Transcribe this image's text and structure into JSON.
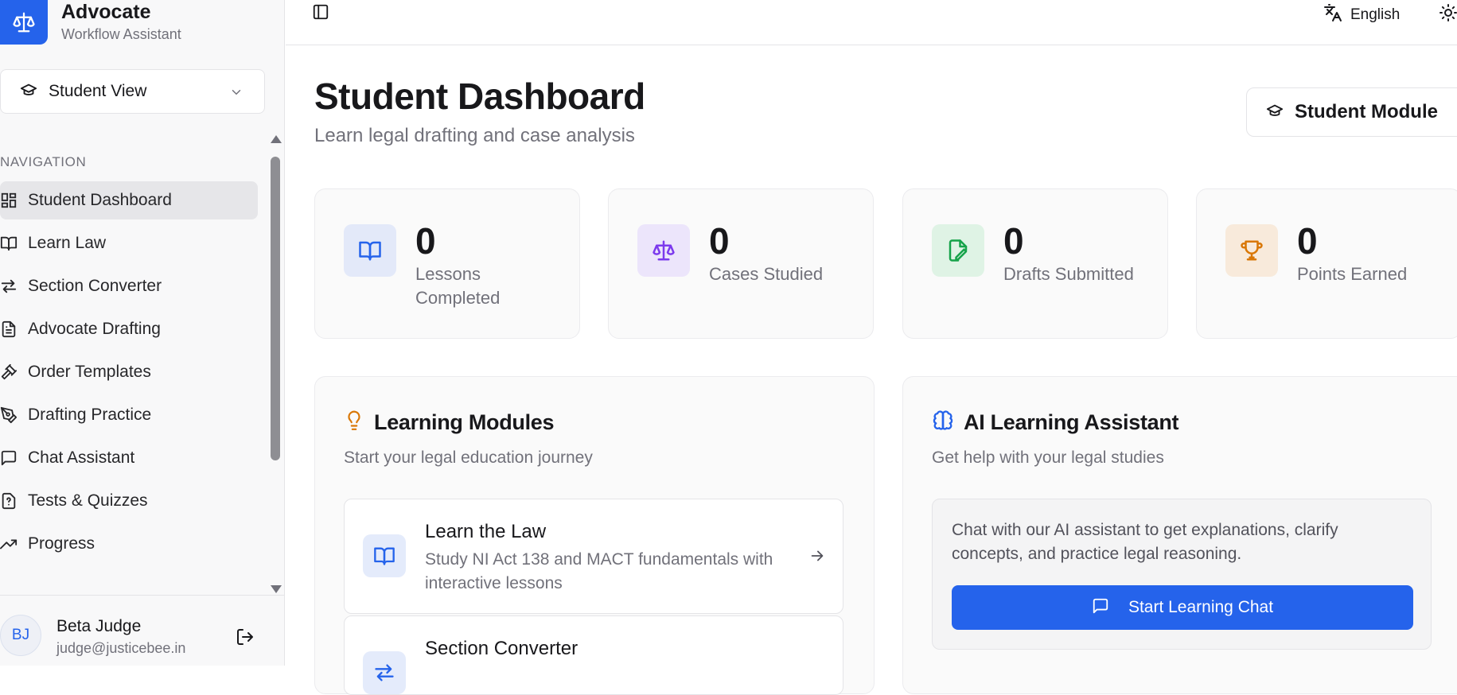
{
  "colors": {
    "accent": "#2563eb",
    "purple": "#7c3aed",
    "green": "#16a34a",
    "amber": "#d97706"
  },
  "brand": {
    "name": "Advocate",
    "subtitle": "Workflow Assistant",
    "icon": "scale-icon"
  },
  "view_select": {
    "value": "Student View",
    "icon": "graduation-cap-icon"
  },
  "nav": {
    "heading": "NAVIGATION",
    "items": [
      {
        "label": "Student Dashboard",
        "icon": "dashboard-icon",
        "active": true
      },
      {
        "label": "Learn Law",
        "icon": "book-icon"
      },
      {
        "label": "Section Converter",
        "icon": "arrows-icon"
      },
      {
        "label": "Advocate Drafting",
        "icon": "document-icon"
      },
      {
        "label": "Order Templates",
        "icon": "gavel-icon"
      },
      {
        "label": "Drafting Practice",
        "icon": "pen-icon"
      },
      {
        "label": "Chat Assistant",
        "icon": "chat-icon"
      },
      {
        "label": "Tests & Quizzes",
        "icon": "quiz-icon"
      },
      {
        "label": "Progress",
        "icon": "trend-icon"
      }
    ]
  },
  "user": {
    "initials": "BJ",
    "name": "Beta Judge",
    "email": "judge@justicebee.in"
  },
  "topbar": {
    "language": "English"
  },
  "page": {
    "title": "Student Dashboard",
    "subtitle": "Learn legal drafting and case analysis",
    "module_button": "Student Module"
  },
  "stats": [
    {
      "value": "0",
      "label": "Lessons Completed",
      "icon": "book-icon"
    },
    {
      "value": "0",
      "label": "Cases Studied",
      "icon": "scale-icon"
    },
    {
      "value": "0",
      "label": "Drafts Submitted",
      "icon": "file-pen-icon"
    },
    {
      "value": "0",
      "label": "Points Earned",
      "icon": "trophy-icon"
    }
  ],
  "learning": {
    "title": "Learning Modules",
    "subtitle": "Start your legal education journey",
    "modules": [
      {
        "title": "Learn the Law",
        "description": "Study NI Act 138 and MACT fundamentals with interactive lessons"
      },
      {
        "title": "Section Converter",
        "description": ""
      }
    ]
  },
  "assistant": {
    "title": "AI Learning Assistant",
    "subtitle": "Get help with your legal studies",
    "description": "Chat with our AI assistant to get explanations, clarify concepts, and practice legal reasoning.",
    "button": "Start Learning Chat"
  }
}
